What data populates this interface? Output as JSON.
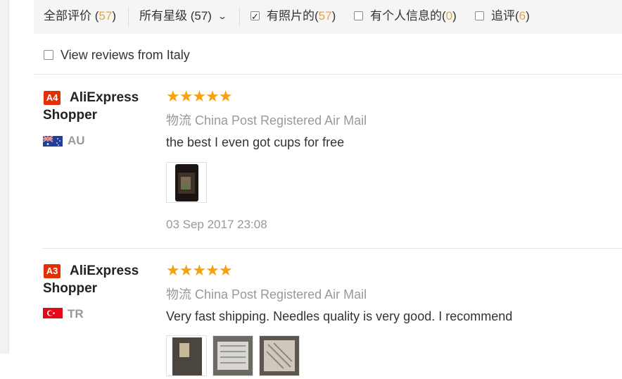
{
  "filters": {
    "all": {
      "label": "全部评价 (",
      "count": "57",
      "close": ")"
    },
    "rating": {
      "label": "所有星级 (57)"
    },
    "photos": {
      "label": "有照片的(",
      "count": "57",
      "close": ")",
      "checked": true
    },
    "personal": {
      "label": "有个人信息的(",
      "count": "0",
      "close": ")",
      "checked": false
    },
    "followup": {
      "label": "追评(",
      "count": "6",
      "close": ")",
      "checked": false
    }
  },
  "country_filter": {
    "label": "View reviews from Italy",
    "checked": false
  },
  "reviews": [
    {
      "level": "A4",
      "name": "AliExpress Shopper",
      "country": "AU",
      "stars": "★★★★★",
      "rating": 5,
      "shipping": "物流 China Post Registered Air Mail",
      "text": "the best I even got cups for free",
      "date": "03 Sep 2017 23:08"
    },
    {
      "level": "A3",
      "name": "AliExpress Shopper",
      "country": "TR",
      "stars": "★★★★★",
      "rating": 5,
      "shipping": "物流 China Post Registered Air Mail",
      "text": "Very fast shipping. Needles quality is very good. I recommend"
    }
  ],
  "colors": {
    "accent_count": "#e8a33b",
    "star": "#f7a10c",
    "level_badge": "#e62e04"
  }
}
